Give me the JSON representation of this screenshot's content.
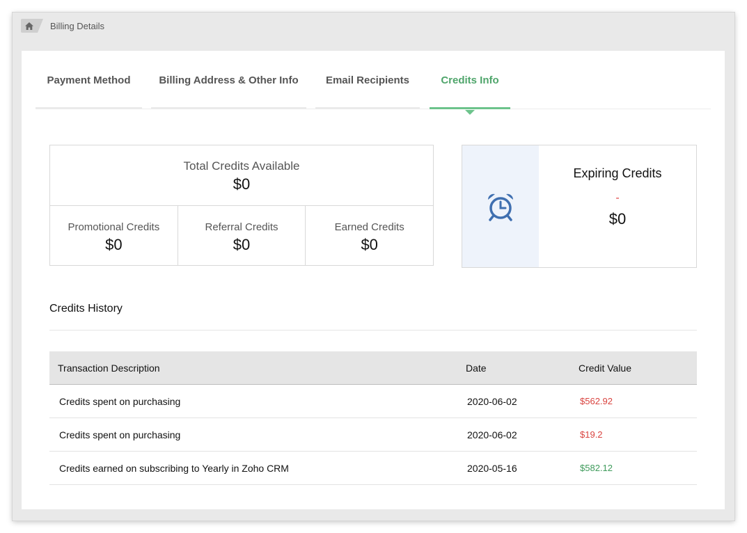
{
  "breadcrumb": {
    "home_icon": "home-icon",
    "current": "Billing Details"
  },
  "tabs": [
    {
      "label": "Payment Method",
      "active": false
    },
    {
      "label": "Billing Address & Other Info",
      "active": false
    },
    {
      "label": "Email Recipients",
      "active": false
    },
    {
      "label": "Credits Info",
      "active": true
    }
  ],
  "credits": {
    "total_label": "Total Credits Available",
    "total_value": "$0",
    "promotional_label": "Promotional Credits",
    "promotional_value": "$0",
    "referral_label": "Referral Credits",
    "referral_value": "$0",
    "earned_label": "Earned Credits",
    "earned_value": "$0"
  },
  "expiring": {
    "icon": "alarm-clock-icon",
    "title": "Expiring Credits",
    "date": "-",
    "value": "$0"
  },
  "history": {
    "title": "Credits History",
    "columns": [
      "Transaction Description",
      "Date",
      "Credit Value"
    ],
    "rows": [
      {
        "description": "Credits spent on purchasing",
        "date": "2020-06-02",
        "value": "$562.92",
        "type": "debit"
      },
      {
        "description": "Credits spent on purchasing",
        "date": "2020-06-02",
        "value": "$19.2",
        "type": "debit"
      },
      {
        "description": "Credits earned on subscribing to Yearly in Zoho CRM",
        "date": "2020-05-16",
        "value": "$582.12",
        "type": "credit"
      }
    ]
  },
  "colors": {
    "accent": "#4fa56b",
    "debit": "#d9433f",
    "credit": "#3d9a5a",
    "icon_blue": "#3f6fb0"
  }
}
